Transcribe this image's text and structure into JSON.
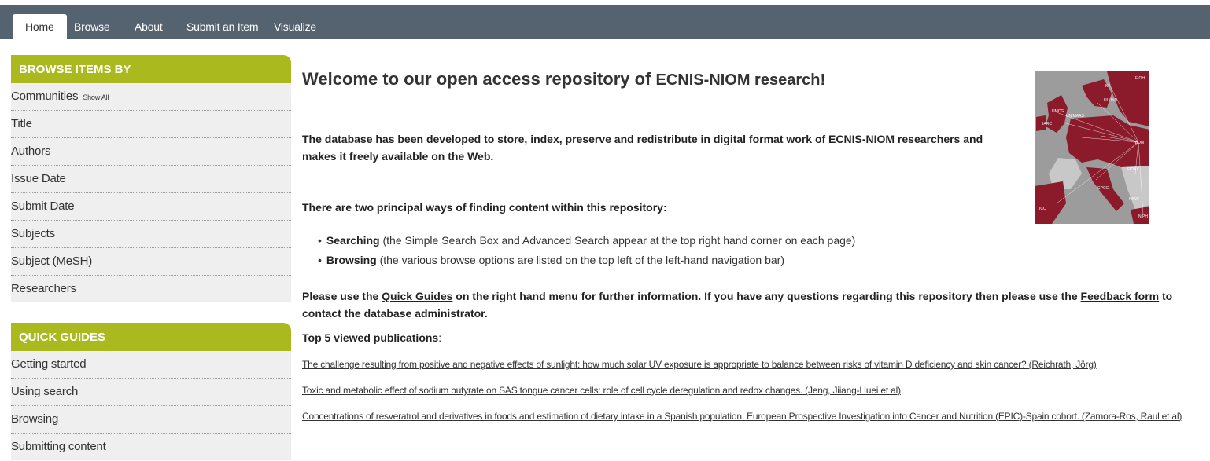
{
  "nav": {
    "tabs": [
      {
        "label": "Home",
        "active": true
      },
      {
        "label": "Browse",
        "active": false
      },
      {
        "label": "About",
        "active": false
      },
      {
        "label": "Submit an Item",
        "active": false
      },
      {
        "label": "Visualize",
        "active": false
      }
    ]
  },
  "sidebar": {
    "browse": {
      "title": "BROWSE ITEMS BY",
      "items": [
        {
          "label": "Communities",
          "extra": "Show All"
        },
        {
          "label": "Title"
        },
        {
          "label": "Authors"
        },
        {
          "label": "Issue Date"
        },
        {
          "label": "Submit Date"
        },
        {
          "label": "Subjects"
        },
        {
          "label": "Subject (MeSH)"
        },
        {
          "label": "Researchers"
        }
      ]
    },
    "guides": {
      "title": "QUICK GUIDES",
      "items": [
        {
          "label": "Getting started"
        },
        {
          "label": "Using search"
        },
        {
          "label": "Browsing"
        },
        {
          "label": "Submitting content"
        }
      ]
    }
  },
  "main": {
    "title_prefix": "Welcome to our open access repository of ",
    "title_brand": "ECNIS-NIOM research!",
    "intro": "The database has been developed to store, index, preserve and redistribute in digital format work of ECNIS-NIOM researchers and makes it freely available on the Web.",
    "ways_heading": "There are two principal ways of finding content within this repository:",
    "bullets": [
      {
        "strong": "Searching",
        "text": " (the Simple Search Box and Advanced Search appear at the top right hand corner on each page)"
      },
      {
        "strong": "Browsing",
        "text": " (the various browse options are listed on the top left of the left-hand navigation bar)"
      }
    ],
    "guides_line": {
      "part1": "Please use the ",
      "link1": "Quick Guides",
      "part2": " on the right hand menu for further information. If you have any questions regarding this repository then please use the ",
      "link2": "Feedback form",
      "part3": " to contact the database administrator."
    },
    "top5_label": "Top 5 viewed publications",
    "top5_colon": ":",
    "publications": [
      "The challenge resulting from positive and negative effects of sunlight: how much solar UV exposure is appropriate to balance between risks of vitamin D deficiency and skin cancer? (Reichrath, Jörg)",
      "Toxic and metabolic effect of sodium butyrate on SAS tongue cancer cells: role of cell cycle deregulation and redox changes. (Jeng, Jiiang-Huei et al)",
      "Concentrations of resveratrol and derivatives in foods and estimation of dietary intake in a Spanish population: European Prospective Investigation into Cancer and Nutrition (EPIC)-Spain cohort. (Zamora-Ros, Raul et al)"
    ],
    "map": {
      "labels": [
        "FIOH",
        "KI",
        "ULUND",
        "UMCG",
        "UNIMAAS",
        "IARC",
        "NIOM",
        "FIOKK",
        "NIPH",
        "CPCC",
        "ICO",
        "NKVF"
      ],
      "land_color": "#8b1a2b",
      "sea_color": "#9c9c9c"
    }
  }
}
